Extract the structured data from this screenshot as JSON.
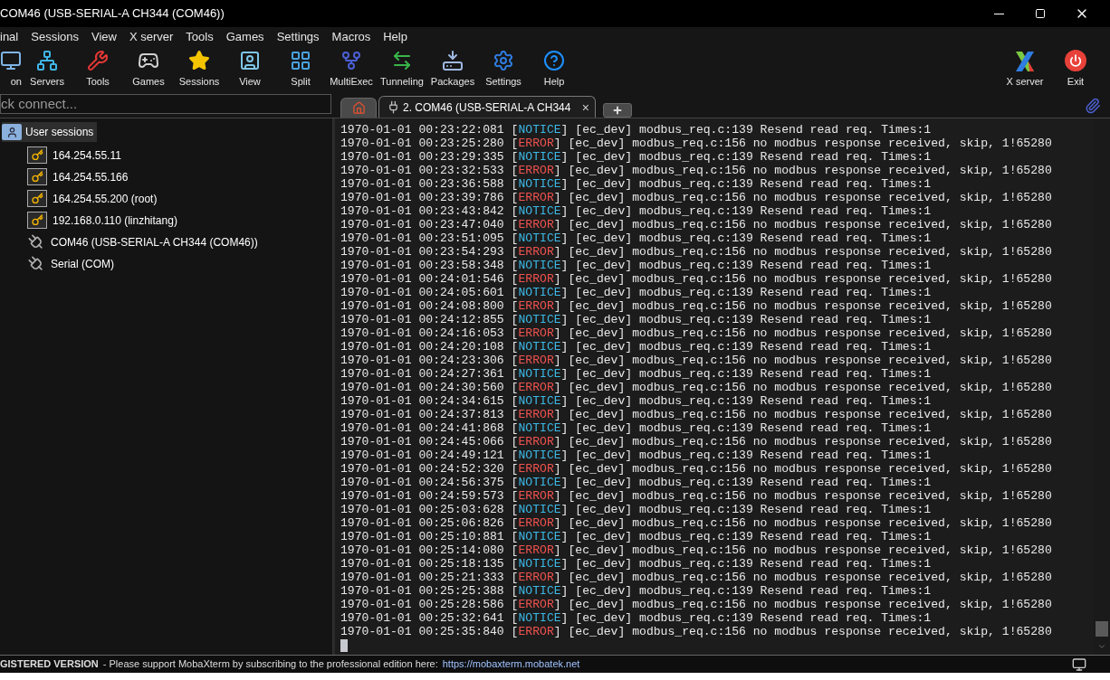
{
  "window": {
    "title": "COM46  (USB-SERIAL-A CH344 (COM46))"
  },
  "menu": [
    "inal",
    "Sessions",
    "View",
    "X server",
    "Tools",
    "Games",
    "Settings",
    "Macros",
    "Help"
  ],
  "toolbar": [
    {
      "label": "on",
      "kind": "session"
    },
    {
      "label": "Servers",
      "kind": "servers"
    },
    {
      "label": "Tools",
      "kind": "tools"
    },
    {
      "label": "Games",
      "kind": "games"
    },
    {
      "label": "Sessions",
      "kind": "sessions"
    },
    {
      "label": "View",
      "kind": "view"
    },
    {
      "label": "Split",
      "kind": "split"
    },
    {
      "label": "MultiExec",
      "kind": "multiexec"
    },
    {
      "label": "Tunneling",
      "kind": "tunneling"
    },
    {
      "label": "Packages",
      "kind": "packages"
    },
    {
      "label": "Settings",
      "kind": "settings"
    },
    {
      "label": "Help",
      "kind": "help"
    }
  ],
  "toolbar_right": [
    {
      "label": "X server",
      "kind": "xserver"
    },
    {
      "label": "Exit",
      "kind": "exit"
    }
  ],
  "quick_connect": {
    "placeholder": "ck connect..."
  },
  "tabs": [
    {
      "kind": "home",
      "selected": false
    },
    {
      "kind": "session",
      "label": "2. COM46  (USB-SERIAL-A CH344",
      "close": "×",
      "selected": true
    },
    {
      "kind": "new",
      "selected": false
    }
  ],
  "sessions": {
    "label": "User sessions",
    "selected": true,
    "children": [
      {
        "label": "164.254.55.11",
        "kind": "ssh",
        "selected": false
      },
      {
        "label": "164.254.55.166",
        "kind": "ssh",
        "selected": false
      },
      {
        "label": "164.254.55.200 (root)",
        "kind": "ssh",
        "selected": false
      },
      {
        "label": "192.168.0.110 (linzhitang)",
        "kind": "ssh",
        "selected": false
      },
      {
        "label": "COM46  (USB-SERIAL-A CH344 (COM46))",
        "kind": "serial",
        "selected": false
      },
      {
        "label": "Serial (COM)",
        "kind": "serial",
        "selected": false
      }
    ]
  },
  "terminal": {
    "lines": [
      {
        "time": "1970-01-01 00:23:22:081 [",
        "level": "NOTICE",
        "kind": "notice",
        "message": "] [ec_dev] modbus_req.c:139 Resend read req. Times:1"
      },
      {
        "time": "1970-01-01 00:23:25:280 [",
        "level": "ERROR",
        "kind": "error",
        "message": "] [ec_dev] modbus_req.c:156 no modbus response received, skip, 1!65280"
      },
      {
        "time": "1970-01-01 00:23:29:335 [",
        "level": "NOTICE",
        "kind": "notice",
        "message": "] [ec_dev] modbus_req.c:139 Resend read req. Times:1"
      },
      {
        "time": "1970-01-01 00:23:32:533 [",
        "level": "ERROR",
        "kind": "error",
        "message": "] [ec_dev] modbus_req.c:156 no modbus response received, skip, 1!65280"
      },
      {
        "time": "1970-01-01 00:23:36:588 [",
        "level": "NOTICE",
        "kind": "notice",
        "message": "] [ec_dev] modbus_req.c:139 Resend read req. Times:1"
      },
      {
        "time": "1970-01-01 00:23:39:786 [",
        "level": "ERROR",
        "kind": "error",
        "message": "] [ec_dev] modbus_req.c:156 no modbus response received, skip, 1!65280"
      },
      {
        "time": "1970-01-01 00:23:43:842 [",
        "level": "NOTICE",
        "kind": "notice",
        "message": "] [ec_dev] modbus_req.c:139 Resend read req. Times:1"
      },
      {
        "time": "1970-01-01 00:23:47:040 [",
        "level": "ERROR",
        "kind": "error",
        "message": "] [ec_dev] modbus_req.c:156 no modbus response received, skip, 1!65280"
      },
      {
        "time": "1970-01-01 00:23:51:095 [",
        "level": "NOTICE",
        "kind": "notice",
        "message": "] [ec_dev] modbus_req.c:139 Resend read req. Times:1"
      },
      {
        "time": "1970-01-01 00:23:54:293 [",
        "level": "ERROR",
        "kind": "error",
        "message": "] [ec_dev] modbus_req.c:156 no modbus response received, skip, 1!65280"
      },
      {
        "time": "1970-01-01 00:23:58:348 [",
        "level": "NOTICE",
        "kind": "notice",
        "message": "] [ec_dev] modbus_req.c:139 Resend read req. Times:1"
      },
      {
        "time": "1970-01-01 00:24:01:546 [",
        "level": "ERROR",
        "kind": "error",
        "message": "] [ec_dev] modbus_req.c:156 no modbus response received, skip, 1!65280"
      },
      {
        "time": "1970-01-01 00:24:05:601 [",
        "level": "NOTICE",
        "kind": "notice",
        "message": "] [ec_dev] modbus_req.c:139 Resend read req. Times:1"
      },
      {
        "time": "1970-01-01 00:24:08:800 [",
        "level": "ERROR",
        "kind": "error",
        "message": "] [ec_dev] modbus_req.c:156 no modbus response received, skip, 1!65280"
      },
      {
        "time": "1970-01-01 00:24:12:855 [",
        "level": "NOTICE",
        "kind": "notice",
        "message": "] [ec_dev] modbus_req.c:139 Resend read req. Times:1"
      },
      {
        "time": "1970-01-01 00:24:16:053 [",
        "level": "ERROR",
        "kind": "error",
        "message": "] [ec_dev] modbus_req.c:156 no modbus response received, skip, 1!65280"
      },
      {
        "time": "1970-01-01 00:24:20:108 [",
        "level": "NOTICE",
        "kind": "notice",
        "message": "] [ec_dev] modbus_req.c:139 Resend read req. Times:1"
      },
      {
        "time": "1970-01-01 00:24:23:306 [",
        "level": "ERROR",
        "kind": "error",
        "message": "] [ec_dev] modbus_req.c:156 no modbus response received, skip, 1!65280"
      },
      {
        "time": "1970-01-01 00:24:27:361 [",
        "level": "NOTICE",
        "kind": "notice",
        "message": "] [ec_dev] modbus_req.c:139 Resend read req. Times:1"
      },
      {
        "time": "1970-01-01 00:24:30:560 [",
        "level": "ERROR",
        "kind": "error",
        "message": "] [ec_dev] modbus_req.c:156 no modbus response received, skip, 1!65280"
      },
      {
        "time": "1970-01-01 00:24:34:615 [",
        "level": "NOTICE",
        "kind": "notice",
        "message": "] [ec_dev] modbus_req.c:139 Resend read req. Times:1"
      },
      {
        "time": "1970-01-01 00:24:37:813 [",
        "level": "ERROR",
        "kind": "error",
        "message": "] [ec_dev] modbus_req.c:156 no modbus response received, skip, 1!65280"
      },
      {
        "time": "1970-01-01 00:24:41:868 [",
        "level": "NOTICE",
        "kind": "notice",
        "message": "] [ec_dev] modbus_req.c:139 Resend read req. Times:1"
      },
      {
        "time": "1970-01-01 00:24:45:066 [",
        "level": "ERROR",
        "kind": "error",
        "message": "] [ec_dev] modbus_req.c:156 no modbus response received, skip, 1!65280"
      },
      {
        "time": "1970-01-01 00:24:49:121 [",
        "level": "NOTICE",
        "kind": "notice",
        "message": "] [ec_dev] modbus_req.c:139 Resend read req. Times:1"
      },
      {
        "time": "1970-01-01 00:24:52:320 [",
        "level": "ERROR",
        "kind": "error",
        "message": "] [ec_dev] modbus_req.c:156 no modbus response received, skip, 1!65280"
      },
      {
        "time": "1970-01-01 00:24:56:375 [",
        "level": "NOTICE",
        "kind": "notice",
        "message": "] [ec_dev] modbus_req.c:139 Resend read req. Times:1"
      },
      {
        "time": "1970-01-01 00:24:59:573 [",
        "level": "ERROR",
        "kind": "error",
        "message": "] [ec_dev] modbus_req.c:156 no modbus response received, skip, 1!65280"
      },
      {
        "time": "1970-01-01 00:25:03:628 [",
        "level": "NOTICE",
        "kind": "notice",
        "message": "] [ec_dev] modbus_req.c:139 Resend read req. Times:1"
      },
      {
        "time": "1970-01-01 00:25:06:826 [",
        "level": "ERROR",
        "kind": "error",
        "message": "] [ec_dev] modbus_req.c:156 no modbus response received, skip, 1!65280"
      },
      {
        "time": "1970-01-01 00:25:10:881 [",
        "level": "NOTICE",
        "kind": "notice",
        "message": "] [ec_dev] modbus_req.c:139 Resend read req. Times:1"
      },
      {
        "time": "1970-01-01 00:25:14:080 [",
        "level": "ERROR",
        "kind": "error",
        "message": "] [ec_dev] modbus_req.c:156 no modbus response received, skip, 1!65280"
      },
      {
        "time": "1970-01-01 00:25:18:135 [",
        "level": "NOTICE",
        "kind": "notice",
        "message": "] [ec_dev] modbus_req.c:139 Resend read req. Times:1"
      },
      {
        "time": "1970-01-01 00:25:21:333 [",
        "level": "ERROR",
        "kind": "error",
        "message": "] [ec_dev] modbus_req.c:156 no modbus response received, skip, 1!65280"
      },
      {
        "time": "1970-01-01 00:25:25:388 [",
        "level": "NOTICE",
        "kind": "notice",
        "message": "] [ec_dev] modbus_req.c:139 Resend read req. Times:1"
      },
      {
        "time": "1970-01-01 00:25:28:586 [",
        "level": "ERROR",
        "kind": "error",
        "message": "] [ec_dev] modbus_req.c:156 no modbus response received, skip, 1!65280"
      },
      {
        "time": "1970-01-01 00:25:32:641 [",
        "level": "NOTICE",
        "kind": "notice",
        "message": "] [ec_dev] modbus_req.c:139 Resend read req. Times:1"
      },
      {
        "time": "1970-01-01 00:25:35:840 [",
        "level": "ERROR",
        "kind": "error",
        "message": "] [ec_dev] modbus_req.c:156 no modbus response received, skip, 1!65280"
      }
    ]
  },
  "status_bar": {
    "edition": "GISTERED VERSION",
    "message": "- Please support MobaXterm by subscribing to the professional edition here:",
    "link": "https://mobaxterm.mobatek.net"
  }
}
